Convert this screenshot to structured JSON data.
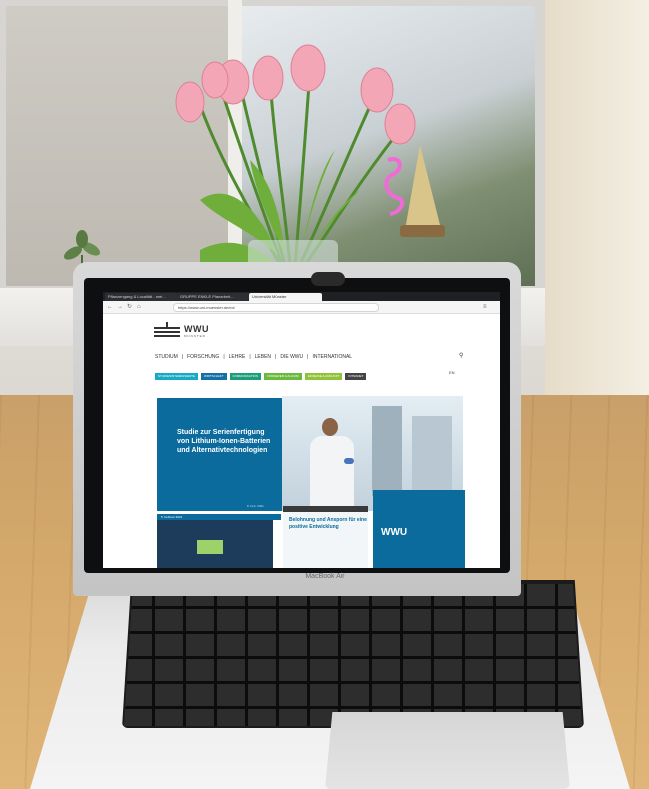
{
  "browser": {
    "tabs": [
      {
        "label": "Pflanzengang & Localität - mei..."
      },
      {
        "label": "GRUPPE ENKLE Planarbeit..."
      },
      {
        "label": "Universität Münster"
      }
    ],
    "url": "https://www.uni-muenster.de/en/",
    "accent": "#1f2024"
  },
  "site": {
    "logo_text": "WWU",
    "logo_sub": "MÜNSTER",
    "menu": [
      "STUDIUM",
      "|",
      "FORSCHUNG",
      "|",
      "LEHRE",
      "|",
      "LEBEN",
      "|",
      "DIE WWU",
      "|",
      "INTERNATIONAL"
    ],
    "chips": [
      {
        "label": "STUDIENINTERESSIERTE",
        "color": "#18a9c4"
      },
      {
        "label": "WIRTSCHAFT",
        "color": "#1570a6"
      },
      {
        "label": "KOMMUNIKATION",
        "color": "#1c9d7b"
      },
      {
        "label": "FÖRDERER & ALUMNI",
        "color": "#6aba3f"
      },
      {
        "label": "EINREISE & ANKUNFT",
        "color": "#92c23c"
      },
      {
        "label": "INTRANET",
        "color": "#444444"
      }
    ],
    "lang": "EN",
    "hero_title": "Studie zur Serienfertigung von Lithium-Ionen-Batterien und Alternativtechnologien",
    "hero_date": "8. Feb. 2021",
    "date_bar": "5. Februar 2021",
    "news_title": "Belohnung und Ansporn für eine positive Entwicklung",
    "side_label": "WWU",
    "primary_color": "#0b6b9c"
  },
  "laptop": {
    "brand_label": "MacBook Air"
  }
}
